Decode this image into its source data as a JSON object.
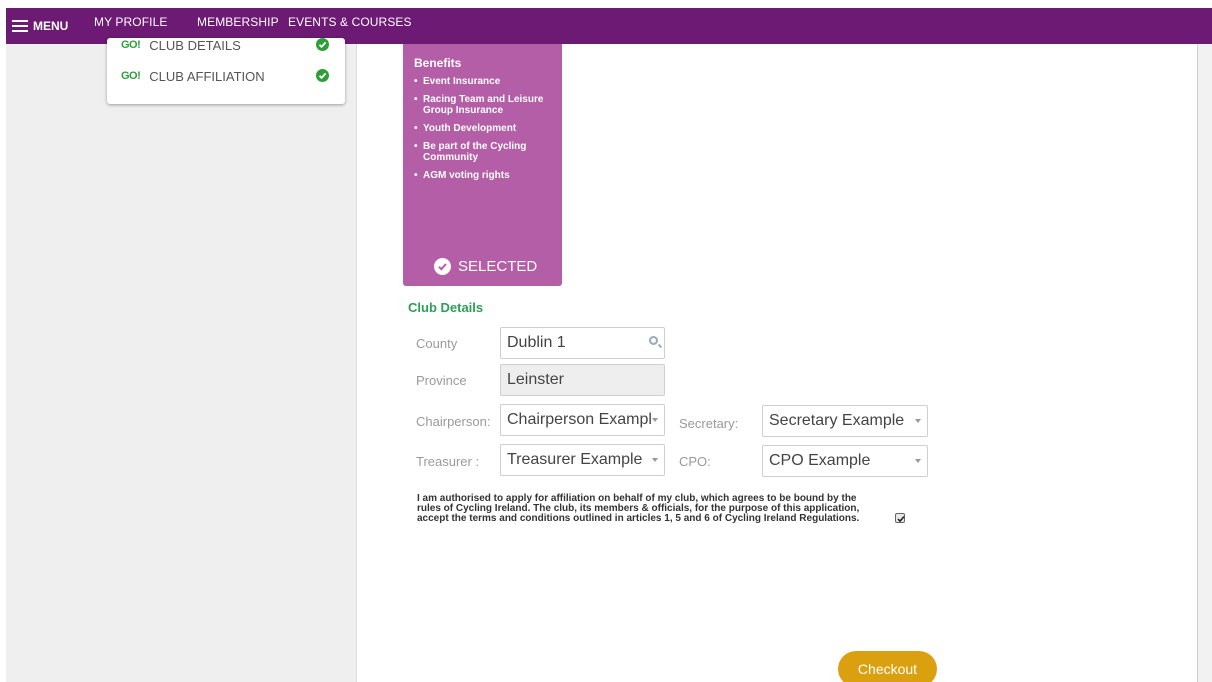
{
  "nav": {
    "menu_label": "MENU",
    "links": [
      "MY PROFILE",
      "MEMBERSHIP",
      "EVENTS & COURSES"
    ]
  },
  "steps": [
    {
      "logo": "GO!",
      "label": "CLUB DETAILS",
      "done": true
    },
    {
      "logo": "GO!",
      "label": "CLUB AFFILIATION",
      "done": true
    }
  ],
  "benefits": {
    "title": "Benefits",
    "items": [
      "Event Insurance",
      "Racing Team and Leisure Group Insurance",
      "Youth Development",
      "Be part of the Cycling Community",
      "AGM voting rights"
    ],
    "selected_label": "SELECTED"
  },
  "form": {
    "section_title": "Club Details",
    "county": {
      "label": "County",
      "value": "Dublin 1"
    },
    "province": {
      "label": "Province",
      "value": "Leinster"
    },
    "chairperson": {
      "label": "Chairperson:",
      "value": "Chairperson Exampl"
    },
    "secretary": {
      "label": "Secretary:",
      "value": "Secretary Example"
    },
    "treasurer": {
      "label": "Treasurer :",
      "value": "Treasurer Example"
    },
    "cpo": {
      "label": "CPO:",
      "value": "CPO Example"
    },
    "terms_text": "I am authorised to apply for affiliation on behalf of my club, which agrees to be bound by the rules of Cycling Ireland. The club, its members & officials, for the purpose of this application, accept the terms and conditions outlined in articles 1, 5 and 6 of Cycling Ireland Regulations.",
    "terms_checked": true,
    "checkout_label": "Checkout"
  },
  "colors": {
    "nav_bg": "#6c1a73",
    "benefits_bg": "#b35ea6",
    "accent_green": "#2e9e3a",
    "checkout_bg": "#dba010"
  }
}
